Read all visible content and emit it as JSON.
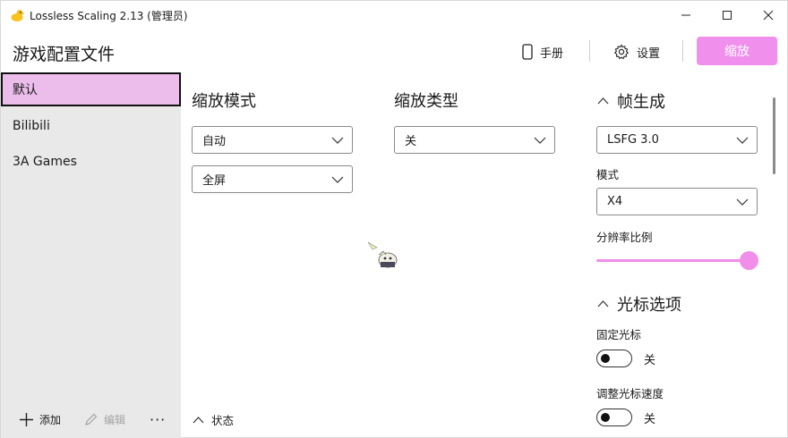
{
  "window": {
    "title": "Lossless Scaling 2.13 (管理员)",
    "icons": {
      "app": "duck-icon",
      "minimize": "minimize-icon",
      "maximize": "maximize-icon",
      "close": "close-icon"
    }
  },
  "header": {
    "title": "游戏配置文件",
    "manual_label": "手册",
    "settings_label": "设置",
    "scale_label": "缩放"
  },
  "sidebar": {
    "profiles": [
      {
        "label": "默认",
        "selected": true
      },
      {
        "label": "Bilibili",
        "selected": false
      },
      {
        "label": "3A Games",
        "selected": false
      }
    ],
    "add_label": "添加",
    "edit_label": "编辑",
    "more_label": "···"
  },
  "main": {
    "scaling_mode": {
      "title": "缩放模式",
      "mode_value": "自动",
      "screen_value": "全屏"
    },
    "scaling_type": {
      "title": "缩放类型",
      "value": "关"
    },
    "status_label": "状态"
  },
  "frame_gen": {
    "title": "帧生成",
    "version_value": "LSFG 3.0",
    "mode_label": "模式",
    "mode_value": "X4",
    "resolution_label": "分辨率比例",
    "resolution_scale_fraction": 1.0
  },
  "cursor": {
    "title": "光标选项",
    "lock_label": "固定光标",
    "lock_state": "关",
    "speed_label": "调整光标速度",
    "speed_state": "关"
  },
  "colors": {
    "accent": "#f090ec",
    "sidebar_bg": "#e9e9e9",
    "selected_bg": "#ecbceb"
  }
}
